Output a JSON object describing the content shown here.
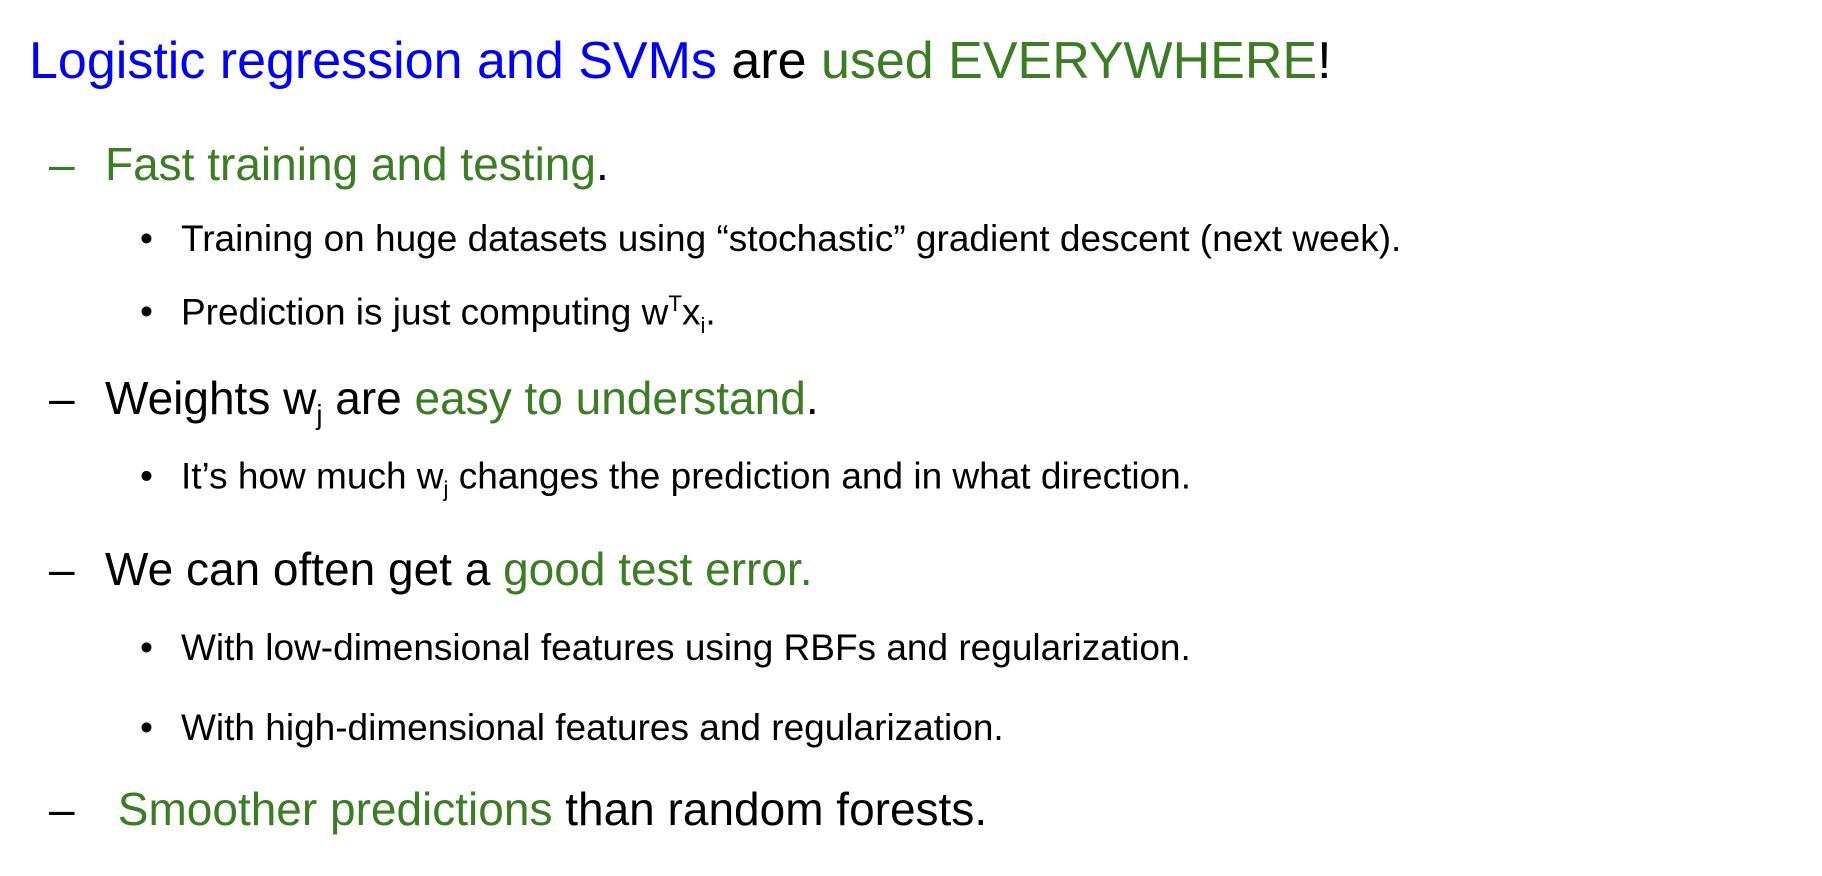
{
  "colors": {
    "blue": "#0000ff",
    "green": "#3a7d22",
    "text": "#000000"
  },
  "title": {
    "part1": "Logistic regression and SVMs",
    "part2": " are ",
    "part3": "used EVERYWHERE",
    "part4": "!"
  },
  "items": [
    {
      "marker": "–",
      "green": "Fast training and testing",
      "rest": "."
    },
    {
      "marker": "•",
      "text": "Training on huge datasets using “stochastic” gradient descent (next week)."
    },
    {
      "marker": "•",
      "text": "Prediction is just computing w",
      "sup": "T",
      "text2": "x",
      "sub": "i",
      "text3": "."
    },
    {
      "marker": "–",
      "text": "Weights w",
      "sub": "j",
      "text2": " are ",
      "green": "easy to understand",
      "rest": "."
    },
    {
      "marker": "•",
      "text": "It’s how much w",
      "sub": "j",
      "text2": " changes the prediction and in what direction."
    },
    {
      "marker": "–",
      "text": "We can often get a ",
      "green": "good test error."
    },
    {
      "marker": "•",
      "text": "With low-dimensional features using RBFs and regularization."
    },
    {
      "marker": "•",
      "text": "With high-dimensional features and regularization."
    },
    {
      "marker": "–",
      "green": " Smoother predictions",
      "rest": " than random forests."
    }
  ]
}
